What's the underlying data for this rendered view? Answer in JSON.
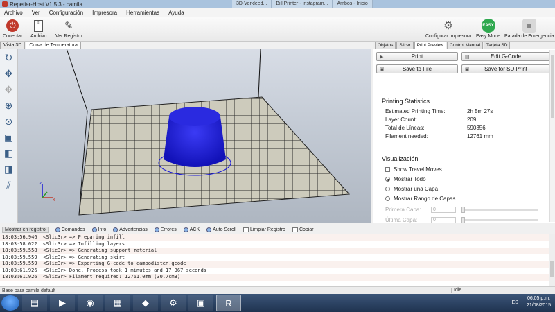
{
  "window": {
    "title": "Repetier-Host V1.5.3 - camila",
    "taskbar_tabs": [
      "3D-Verkleed...",
      "Bill Printer - Instagram...",
      "Ambos - Inicio"
    ]
  },
  "menu": [
    "Archivo",
    "Ver",
    "Configuración",
    "Impresora",
    "Herramientas",
    "Ayuda"
  ],
  "toolbar": {
    "connect": "Conectar",
    "file": "Archivo",
    "log": "Ver Registro",
    "printer_settings": "Configurar Impresora",
    "easy_mode": "Easy Mode",
    "easy_badge": "EASY",
    "emergency": "Parada de Emergencia"
  },
  "view_tabs": [
    "Vista 3D",
    "Curva de Temperatura"
  ],
  "right_tabs": [
    "Objetos",
    "Slicer",
    "Print Preview",
    "Control Manual",
    "Tarjeta SD"
  ],
  "preview": {
    "print": "Print",
    "edit_gcode": "Edit G-Code",
    "save_file": "Save to File",
    "save_sd": "Save for SD Print",
    "stats_title": "Printing Statistics",
    "stats": [
      {
        "k": "Estimated Printing Time:",
        "v": "2h 5m 27s"
      },
      {
        "k": "Layer Count:",
        "v": "209"
      },
      {
        "k": "Total de Líneas:",
        "v": "590356"
      },
      {
        "k": "Filament needed:",
        "v": "12761 mm"
      }
    ],
    "viz_title": "Visualización",
    "show_travel": "Show Travel Moves",
    "show_all": "Mostrar Todo",
    "show_one": "Mostrar una Capa",
    "show_range": "Mostrar Rango de Capas",
    "first_layer": "Primera Capa:",
    "last_layer": "Última Capa:",
    "first_val": "0",
    "last_val": "0"
  },
  "log_toolbar": [
    "Mostrar en registro",
    "Comandos",
    "Info",
    "Advertencias",
    "Errores",
    "ACK",
    "Auto Scroll",
    "Limpiar Registro",
    "Copiar"
  ],
  "log": [
    {
      "t": "18:03:56.946",
      "m": "<Slic3r> => Preparing infill"
    },
    {
      "t": "18:03:58.022",
      "m": "<Slic3r> => Infilling layers"
    },
    {
      "t": "18:03:59.558",
      "m": "<Slic3r> => Generating support material"
    },
    {
      "t": "18:03:59.559",
      "m": "<Slic3r> => Generating skirt"
    },
    {
      "t": "18:03:59.559",
      "m": "<Slic3r> => Exporting G-code to campodisten.gcode"
    },
    {
      "t": "18:03:61.926",
      "m": "<Slic3r> Done. Process took 1 minutes and 17.367 seconds"
    },
    {
      "t": "18:03:61.926",
      "m": "<Slic3r> Filament required: 12761.0mm (30.7cm3)"
    }
  ],
  "status": {
    "left": "Base para camila default",
    "right": "Idle"
  },
  "tray": {
    "lang": "ES",
    "time": "06:05 p.m.",
    "date": "21/08/2015"
  },
  "colors": {
    "model": "#1a1ad8",
    "bed": "#cdcbbc",
    "accent": "#3b5f87"
  }
}
